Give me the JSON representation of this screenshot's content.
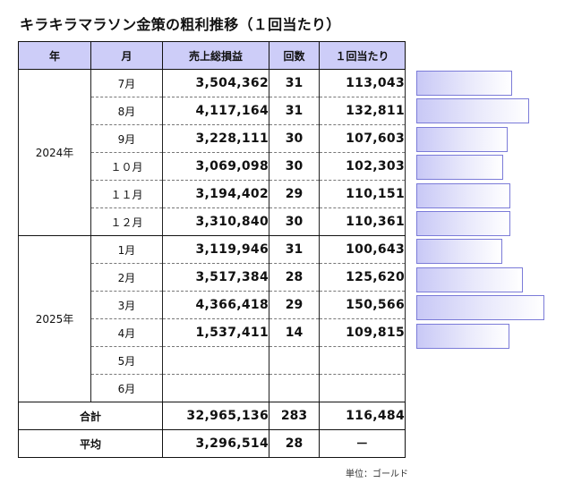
{
  "title": "キラキラマラソン金策の粗利推移（１回当たり）",
  "headers": {
    "year": "年",
    "month": "月",
    "sales": "売上総損益",
    "count": "回数",
    "per": "１回当たり"
  },
  "years": [
    {
      "label": "2024年",
      "rows": [
        {
          "month": "7月",
          "sales": "3,504,362",
          "count": "31",
          "per": "113,043",
          "per_value": 113043
        },
        {
          "month": "8月",
          "sales": "4,117,164",
          "count": "31",
          "per": "132,811",
          "per_value": 132811
        },
        {
          "month": "9月",
          "sales": "3,228,111",
          "count": "30",
          "per": "107,603",
          "per_value": 107603
        },
        {
          "month": "１０月",
          "sales": "3,069,098",
          "count": "30",
          "per": "102,303",
          "per_value": 102303
        },
        {
          "month": "１１月",
          "sales": "3,194,402",
          "count": "29",
          "per": "110,151",
          "per_value": 110151
        },
        {
          "month": "１２月",
          "sales": "3,310,840",
          "count": "30",
          "per": "110,361",
          "per_value": 110361
        }
      ]
    },
    {
      "label": "2025年",
      "rows": [
        {
          "month": "1月",
          "sales": "3,119,946",
          "count": "31",
          "per": "100,643",
          "per_value": 100643
        },
        {
          "month": "2月",
          "sales": "3,517,384",
          "count": "28",
          "per": "125,620",
          "per_value": 125620
        },
        {
          "month": "3月",
          "sales": "4,366,418",
          "count": "29",
          "per": "150,566",
          "per_value": 150566
        },
        {
          "month": "4月",
          "sales": "1,537,411",
          "count": "14",
          "per": "109,815",
          "per_value": 109815
        },
        {
          "month": "5月",
          "sales": "",
          "count": "",
          "per": "",
          "per_value": null
        },
        {
          "month": "6月",
          "sales": "",
          "count": "",
          "per": "",
          "per_value": null
        }
      ]
    }
  ],
  "total": {
    "label": "合計",
    "sales": "32,965,136",
    "count": "283",
    "per": "116,484"
  },
  "average": {
    "label": "平均",
    "sales": "3,296,514",
    "count": "28",
    "per": "－"
  },
  "unit": "単位：ゴールド",
  "bar_scale_max": 160000,
  "colors": {
    "header_bg": "#cdcdf8",
    "bar_border": "#7b7bd8",
    "bar_fill": "#c8c8f6"
  }
}
